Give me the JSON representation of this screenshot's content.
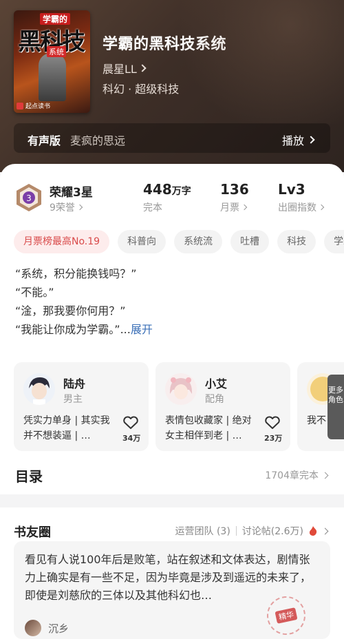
{
  "book": {
    "title": "学霸的黑科技系统",
    "author": "晨星LL",
    "genre": "科幻 · 超级科技",
    "cover": {
      "top_tag": "学霸的",
      "big_text": "黑科技",
      "sub_tag": "系统",
      "publisher": "起点读书"
    }
  },
  "audio": {
    "label": "有声版",
    "reader": "麦疯的思远",
    "play": "播放"
  },
  "stats": {
    "honor_name": "荣耀3星",
    "honor_sub": "9荣誉",
    "badge_num": "3",
    "words_value": "448",
    "words_unit": "万字",
    "words_label": "完本",
    "tickets_value": "136",
    "tickets_label": "月票",
    "level_value": "Lv3",
    "level_label": "出圈指数"
  },
  "tags": [
    "月票榜最高No.19",
    "科普向",
    "系统流",
    "吐槽",
    "科技",
    "学霸"
  ],
  "intro": {
    "lines": [
      "“系统，积分能换钱吗？”",
      "“不能。”",
      "“淦，那我要你何用？”",
      "“我能让你成为学霸。”"
    ],
    "ellipsis": "...",
    "expand": "展开"
  },
  "characters": [
    {
      "name": "陆舟",
      "role": "男主",
      "desc": "凭实力单身 | 其实我并不想装逼 | …",
      "likes": "34万"
    },
    {
      "name": "小艾",
      "role": "配角",
      "desc": "表情包收藏家 | 绝对女主相伴到老 | …",
      "likes": "23万"
    },
    {
      "name": "",
      "role": "",
      "desc": "我不 | 姐 | 悄悄",
      "likes": ""
    }
  ],
  "more_roles": "更多角色",
  "toc": {
    "title": "目录",
    "info": "1704章完本"
  },
  "friends": {
    "title": "书友圈",
    "team": "运营团队 (3)",
    "posts_count": "讨论帖(2.6万)",
    "post_text": "看见有人说100年后是败笔，站在叙述和文体表达，剧情张力上确实是有一些不足，因为毕竟是涉及到遥远的未来了，即使是刘慈欣的三体以及其他科幻也…",
    "post_user": "沉乡",
    "stamp": "精华"
  }
}
